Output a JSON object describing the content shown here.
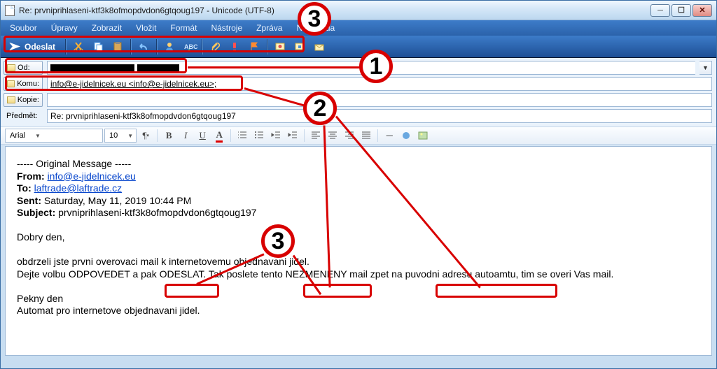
{
  "window": {
    "title": "Re: prvniprihlaseni-ktf3k8ofmopdvdon6gtqoug197 - Unicode (UTF-8)"
  },
  "menus": [
    "Soubor",
    "Úpravy",
    "Zobrazit",
    "Vložit",
    "Formát",
    "Nástroje",
    "Zpráva",
    "Nápověda"
  ],
  "toolbar": {
    "send_label": "Odeslat"
  },
  "headers": {
    "from_label": "Od:",
    "to_label": "Komu:",
    "to_value": "info@e-jidelnicek.eu <info@e-jidelnicek.eu>;",
    "cc_label": "Kopie:",
    "cc_value": "",
    "subject_label": "Předmět:",
    "subject_value": "Re: prvniprihlaseni-ktf3k8ofmopdvdon6gtqoug197"
  },
  "format": {
    "font_name": "Arial",
    "font_size": "10"
  },
  "body": {
    "orig_header": "----- Original Message -----",
    "from_lbl": "From:",
    "from_link": "info@e-jidelnicek.eu",
    "to_lbl": "To:",
    "to_link": "laftrade@laftrade.cz",
    "sent_lbl": "Sent:",
    "sent_val": " Saturday, May 11, 2019 10:44 PM",
    "subj_lbl": "Subject:",
    "subj_val": " prvniprihlaseni-ktf3k8ofmopdvdon6gtqoug197",
    "greeting": "Dobry den,",
    "p1": "obdrzeli jste prvni overovaci mail k internetovemu objednavani jidel.",
    "p2a": "Dejte volbu ODPOVEDET a pak ",
    "p2b": "ODESLAT.",
    "p2c": " Tak poslete tento ",
    "p2d": "NEZMENENY",
    "p2e": " mail zpet na ",
    "p2f": "puvodni adresu autoamtu,",
    "p2g": " tim se overi Vas mail.",
    "p3": "Pekny den",
    "p4": "Automat pro internetove objednavani jidel."
  },
  "callouts": {
    "one": "1",
    "two": "2",
    "three": "3"
  }
}
